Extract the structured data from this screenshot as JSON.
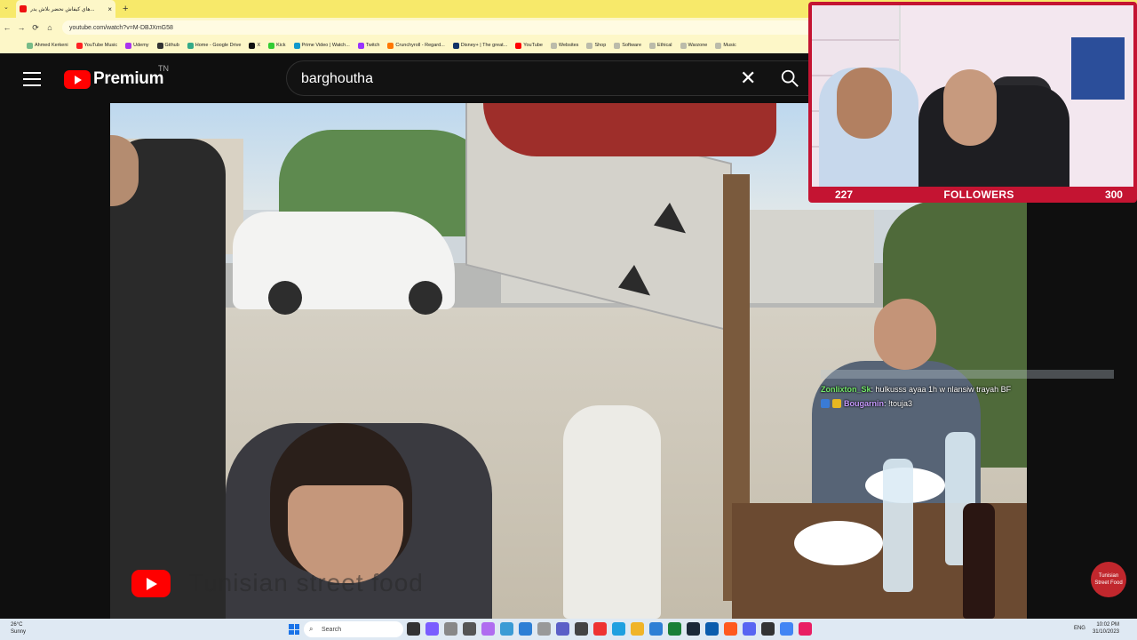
{
  "browser": {
    "tab_title": "هاي كيفاش نحضر بلاش يدر...",
    "tab_close": "×",
    "new_tab": "+",
    "url": "youtube.com/watch?v=M-DBJXmG58",
    "nav": {
      "back": "←",
      "forward": "→",
      "reload": "⟳",
      "home": "⌂"
    },
    "bookmarks": [
      {
        "label": "Ahmed Kerkeni",
        "color": "#7b8"
      },
      {
        "label": "YouTube Music",
        "color": "#f22"
      },
      {
        "label": "Udemy",
        "color": "#a3e"
      },
      {
        "label": "Github",
        "color": "#333"
      },
      {
        "label": "Home - Google Drive",
        "color": "#3a8"
      },
      {
        "label": "X",
        "color": "#111"
      },
      {
        "label": "Kick",
        "color": "#3c3"
      },
      {
        "label": "Prime Video | Watch...",
        "color": "#19c"
      },
      {
        "label": "Twitch",
        "color": "#93f"
      },
      {
        "label": "Crunchyroll - Regard...",
        "color": "#f70"
      },
      {
        "label": "Disney+ | The great...",
        "color": "#136"
      },
      {
        "label": "YouTube",
        "color": "#f00"
      },
      {
        "label": "Websites",
        "color": "#bba"
      },
      {
        "label": "Shop",
        "color": "#bba"
      },
      {
        "label": "Software",
        "color": "#bba"
      },
      {
        "label": "Ethical",
        "color": "#bba"
      },
      {
        "label": "Warzone",
        "color": "#bba"
      },
      {
        "label": "Music",
        "color": "#bba"
      }
    ]
  },
  "youtube": {
    "brand": "Premium",
    "region": "TN",
    "search_query": "barghoutha",
    "clear_icon": "✕",
    "video_watermark": "Tunisian street food"
  },
  "chat": [
    {
      "user": "Zonlixton_Sk",
      "message": ": hulkusss ayaa 1h w nlansiw trayah BF"
    },
    {
      "user": "Bougarnin",
      "message": ": !touja3"
    }
  ],
  "webcam": {
    "left_count": "227",
    "label": "FOLLOWERS",
    "right_count": "300"
  },
  "corner_logo": "Tunisian Street Food",
  "taskbar": {
    "weather_temp": "26°C",
    "weather_desc": "Sunny",
    "search_placeholder": "Search",
    "language": "ENG",
    "time": "10:02 PM",
    "date": "31/10/2023"
  },
  "colors": {
    "tabstrip": "#f7e96a",
    "yt_red": "#ff0000",
    "cam_frame": "#c41432"
  }
}
